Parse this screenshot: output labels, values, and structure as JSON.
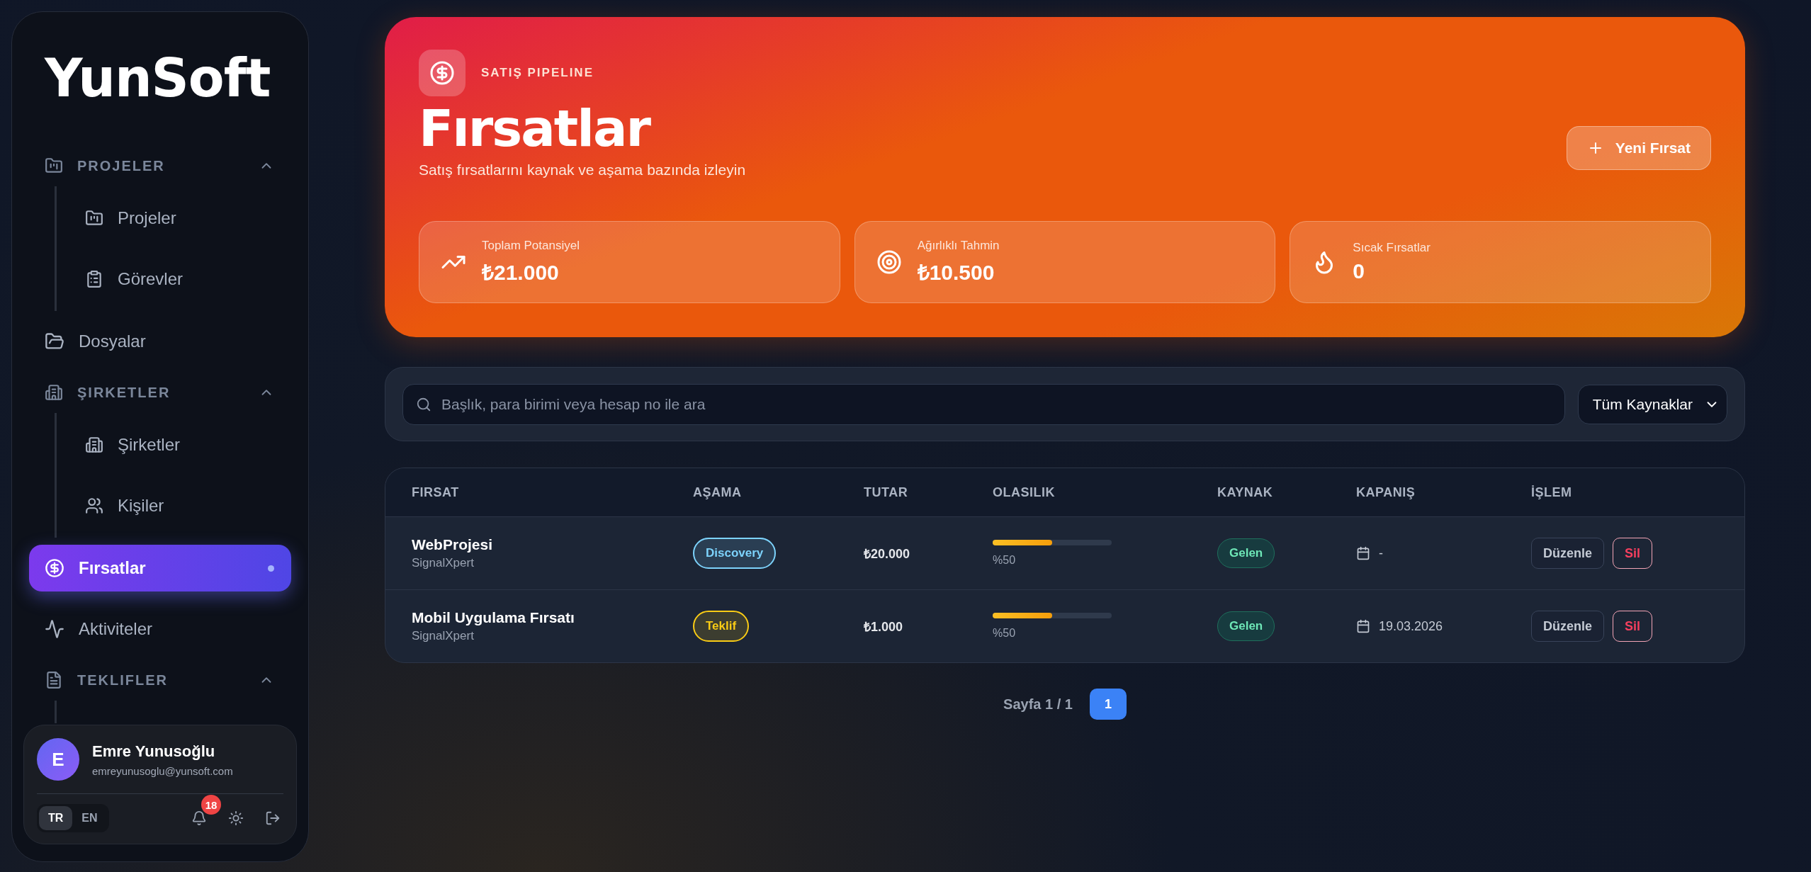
{
  "sidebar": {
    "logo": "YunSoft",
    "nav": [
      {
        "kind": "group",
        "label": "PROJELER",
        "expanded": true,
        "children": [
          {
            "label": "Projeler",
            "selected": false
          },
          {
            "label": "Görevler",
            "selected": false
          }
        ]
      },
      {
        "kind": "item",
        "label": "Dosyalar",
        "selected": false
      },
      {
        "kind": "group",
        "label": "ŞIRKETLER",
        "expanded": true,
        "children": [
          {
            "label": "Şirketler",
            "selected": false
          },
          {
            "label": "Kişiler",
            "selected": false
          }
        ]
      },
      {
        "kind": "item",
        "label": "Fırsatlar",
        "selected": true
      },
      {
        "kind": "item",
        "label": "Aktiviteler",
        "selected": false
      },
      {
        "kind": "group",
        "label": "TEKLIFLER",
        "expanded": true
      }
    ],
    "user": {
      "initial": "E",
      "name": "Emre Yunusoğlu",
      "email": "emreyunusoglu@yunsoft.com",
      "languages": [
        {
          "label": "TR",
          "selected": true
        },
        {
          "label": "EN",
          "selected": false
        }
      ],
      "notification_count": "18"
    }
  },
  "hero": {
    "eyebrow": "SATIŞ PIPELINE",
    "title": "Fırsatlar",
    "subtitle": "Satış fırsatlarını kaynak ve aşama bazında izleyin",
    "new_button": "Yeni Fırsat",
    "stats": [
      {
        "label": "Toplam Potansiyel",
        "value": "₺21.000"
      },
      {
        "label": "Ağırlıklı Tahmin",
        "value": "₺10.500"
      },
      {
        "label": "Sıcak Fırsatlar",
        "value": "0"
      }
    ]
  },
  "filters": {
    "search": {
      "placeholder": "Başlık, para birimi veya hesap no ile ara"
    },
    "source_select": "Tüm Kaynaklar"
  },
  "table": {
    "columns": [
      "FIRSAT",
      "AŞAMA",
      "TUTAR",
      "OLASILIK",
      "KAYNAK",
      "KAPANIŞ",
      "İŞLEM"
    ],
    "rows": [
      {
        "title": "WebProjesi",
        "company": "SignalXpert",
        "stage": {
          "label": "Discovery",
          "color": "#7dd3fc"
        },
        "amount": "₺20.000",
        "level": 0.5,
        "probability": "%50",
        "source": "Gelen",
        "close_date": "-",
        "edit": "Düzenle",
        "delete": "Sil"
      },
      {
        "title": "Mobil Uygulama Fırsatı",
        "company": "SignalXpert",
        "stage": {
          "label": "Teklif",
          "color": "#facc15"
        },
        "amount": "₺1.000",
        "level": 0.5,
        "probability": "%50",
        "source": "Gelen",
        "close_date": "19.03.2026",
        "edit": "Düzenle",
        "delete": "Sil"
      }
    ]
  },
  "pagination": {
    "label": "Sayfa 1 / 1",
    "pages": [
      {
        "label": "1",
        "selected": true
      }
    ]
  }
}
